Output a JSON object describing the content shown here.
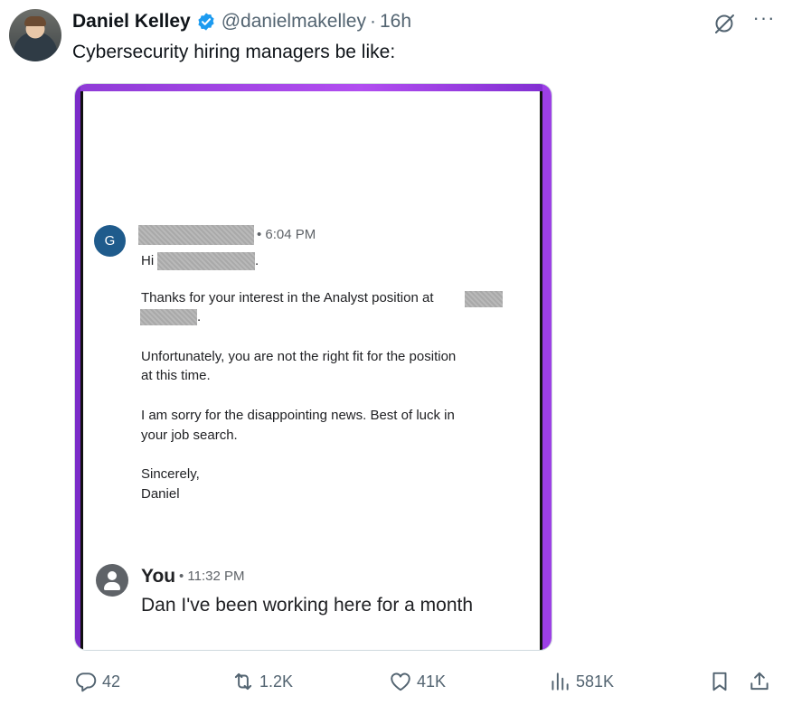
{
  "tweet": {
    "author_name": "Daniel Kelley",
    "handle": "@danielmakelley",
    "separator": "·",
    "time": "16h",
    "text": "Cybersecurity hiring managers be like:"
  },
  "email": {
    "sender_initial": "G",
    "time": "• 6:04 PM",
    "greeting": "Hi",
    "line1": "Thanks for your interest in the Analyst position at",
    "line2": "Unfortunately, you are not the right fit for the position",
    "line3": "at this time.",
    "line4": "I am sorry for the disappointing news. Best of luck in",
    "line5": "your job search.",
    "line6": "Sincerely,",
    "line7": "Daniel",
    "period": "."
  },
  "reply": {
    "name": "You",
    "time": "• 11:32 PM",
    "message": "Dan I've been working here for a month"
  },
  "actions": {
    "replies": "42",
    "reposts": "1.2K",
    "likes": "41K",
    "views": "581K"
  },
  "more_label": "···",
  "colors": {
    "verified": "#1d9bf0",
    "muted": "#536471",
    "frame_purple": "#9d3fe6"
  }
}
